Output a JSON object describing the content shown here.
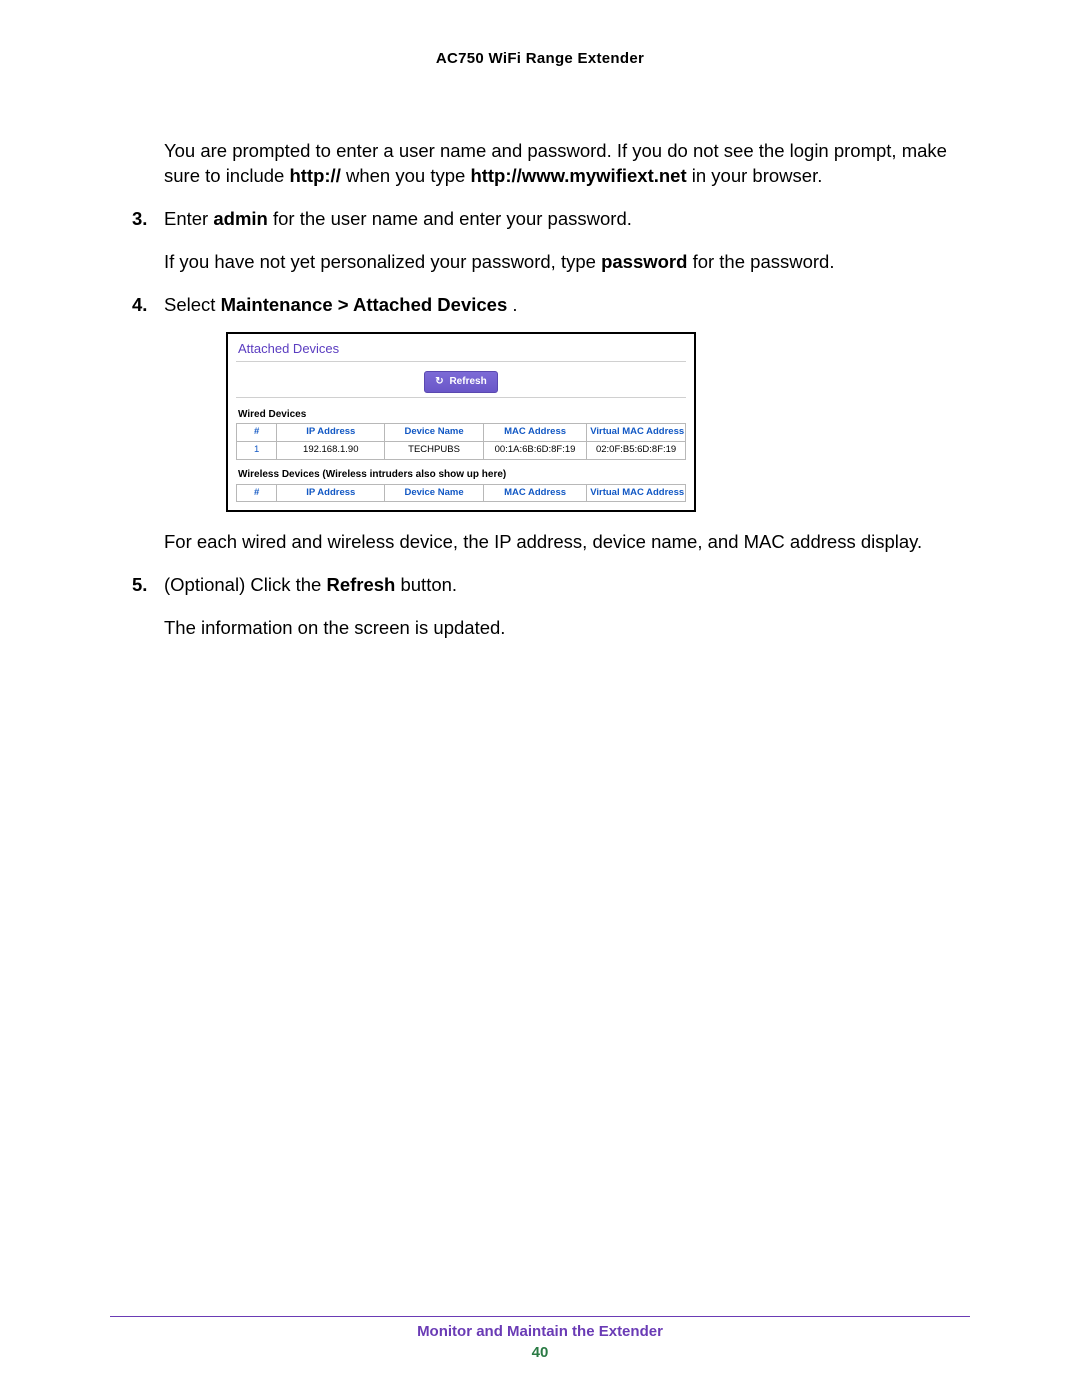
{
  "header": {
    "title": "AC750 WiFi Range Extender"
  },
  "intro": {
    "prefix": "You are prompted to enter a user name and password. If you do not see the login prompt, make sure to include ",
    "bold1": "http://",
    "mid": " when you type ",
    "bold2": "http://www.mywifiext.net",
    "suffix": " in your browser."
  },
  "steps": {
    "s3": {
      "num": "3.",
      "prefix": "Enter ",
      "bold1": "admin",
      "mid": " for the user name and enter your password.",
      "follow_prefix": "If you have not yet personalized your password, type ",
      "follow_bold": "password",
      "follow_suffix": " for the password."
    },
    "s4": {
      "num": "4.",
      "prefix": "Select ",
      "bold1": "Maintenance > Attached Devices",
      "suffix": ".",
      "after": "For each wired and wireless device, the IP address, device name, and MAC address display."
    },
    "s5": {
      "num": "5.",
      "prefix": "(Optional) Click the ",
      "bold1": "Refresh",
      "suffix": " button.",
      "follow": "The information on the screen is updated."
    }
  },
  "panel": {
    "title": "Attached Devices",
    "refresh_label": "Refresh",
    "wired_label": "Wired Devices",
    "wireless_label": "Wireless Devices (Wireless intruders also show up here)",
    "columns": {
      "num": "#",
      "ip": "IP Address",
      "name": "Device Name",
      "mac": "MAC Address",
      "vmac": "Virtual MAC Address"
    },
    "wired_rows": [
      {
        "num": "1",
        "ip": "192.168.1.90",
        "name": "TECHPUBS",
        "mac": "00:1A:6B:6D:8F:19",
        "vmac": "02:0F:B5:6D:8F:19"
      }
    ]
  },
  "footer": {
    "section": "Monitor and Maintain the Extender",
    "page": "40"
  }
}
